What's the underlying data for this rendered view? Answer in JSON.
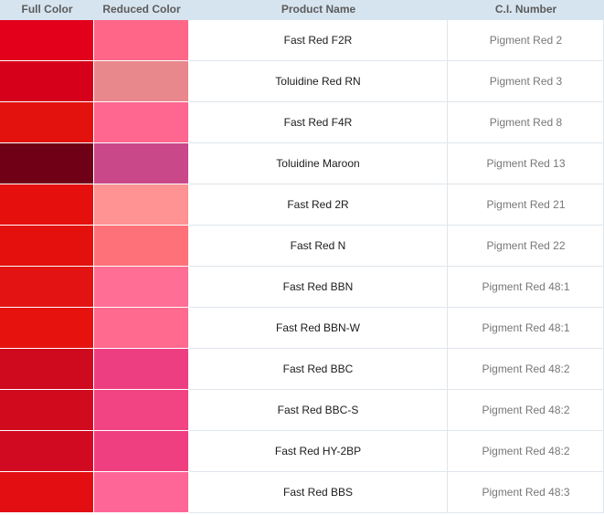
{
  "header": {
    "full_color": "Full Color",
    "reduced_color": "Reduced Color",
    "product_name": "Product Name",
    "ci_number": "C.I. Number"
  },
  "rows": [
    {
      "full_color": "#e2001b",
      "reduced_color": "#ff6688",
      "product_name": "Fast Red F2R",
      "ci_number": "Pigment Red 2"
    },
    {
      "full_color": "#d6001a",
      "reduced_color": "#e8888c",
      "product_name": "Toluidine Red RN",
      "ci_number": "Pigment Red 3"
    },
    {
      "full_color": "#e3120f",
      "reduced_color": "#ff6690",
      "product_name": "Fast Red F4R",
      "ci_number": "Pigment Red 8"
    },
    {
      "full_color": "#6f0016",
      "reduced_color": "#c8488a",
      "product_name": "Toluidine Maroon",
      "ci_number": "Pigment Red 13"
    },
    {
      "full_color": "#e5100d",
      "reduced_color": "#ff9292",
      "product_name": "Fast Red 2R",
      "ci_number": "Pigment Red 21"
    },
    {
      "full_color": "#e3100e",
      "reduced_color": "#ff7178",
      "product_name": "Fast Red N",
      "ci_number": "Pigment Red 22"
    },
    {
      "full_color": "#e31313",
      "reduced_color": "#ff6e94",
      "product_name": "Fast Red BBN",
      "ci_number": "Pigment Red 48:1"
    },
    {
      "full_color": "#e6120e",
      "reduced_color": "#ff6a8e",
      "product_name": "Fast Red BBN-W",
      "ci_number": "Pigment Red 48:1"
    },
    {
      "full_color": "#cf0a1e",
      "reduced_color": "#ee3e82",
      "product_name": "Fast Red BBC",
      "ci_number": "Pigment Red 48:2"
    },
    {
      "full_color": "#d20a1e",
      "reduced_color": "#f24382",
      "product_name": "Fast Red BBC-S",
      "ci_number": "Pigment Red 48:2"
    },
    {
      "full_color": "#d10a22",
      "reduced_color": "#f03f80",
      "product_name": "Fast Red HY-2BP",
      "ci_number": "Pigment Red 48:2"
    },
    {
      "full_color": "#e20e12",
      "reduced_color": "#ff6698",
      "product_name": "Fast Red BBS",
      "ci_number": "Pigment Red 48:3"
    }
  ]
}
